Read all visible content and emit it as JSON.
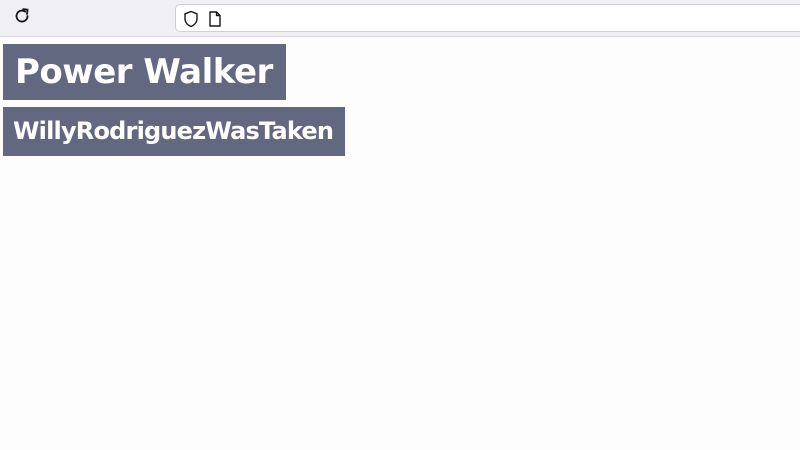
{
  "browser": {
    "url": "",
    "icons": {
      "reload": "reload-icon",
      "shield": "shield-icon",
      "page": "page-icon"
    }
  },
  "page": {
    "title": "Power Walker",
    "subtitle": "WillyRodriguezWasTaken",
    "colors": {
      "label_background": "#626880",
      "label_text": "#ffffff",
      "page_background": "#fdfdfd"
    }
  }
}
